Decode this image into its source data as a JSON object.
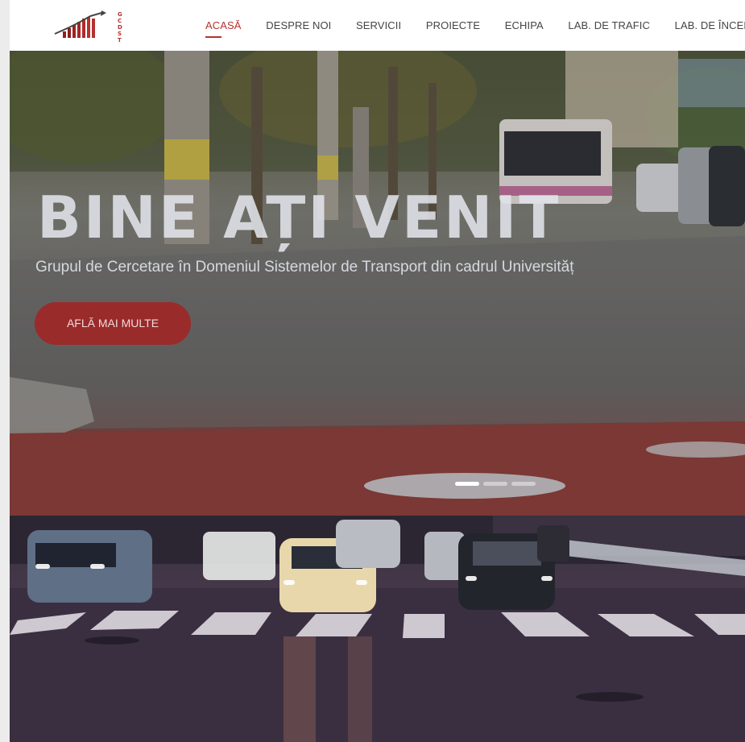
{
  "nav": {
    "items": [
      {
        "label": "ACASĂ",
        "active": true
      },
      {
        "label": "DESPRE NOI",
        "active": false
      },
      {
        "label": "SERVICII",
        "active": false
      },
      {
        "label": "PROIECTE",
        "active": false
      },
      {
        "label": "ECHIPA",
        "active": false
      },
      {
        "label": "LAB. DE TRAFIC",
        "active": false
      },
      {
        "label": "LAB. DE ÎNCERCĂ",
        "active": false
      }
    ],
    "logo_letters": [
      "G",
      "C",
      "D",
      "S",
      "T"
    ],
    "accent": "#b5322f"
  },
  "hero": {
    "title": "BINE AȚI VENIT",
    "subtitle": "Grupul de Cercetare în Domeniul Sistemelor de Transport din cadrul Universităț",
    "cta_label": "AFLĂ MAI MULTE",
    "slides_total": 3,
    "slide_active": 1,
    "button_color": "#9a2b2b"
  }
}
